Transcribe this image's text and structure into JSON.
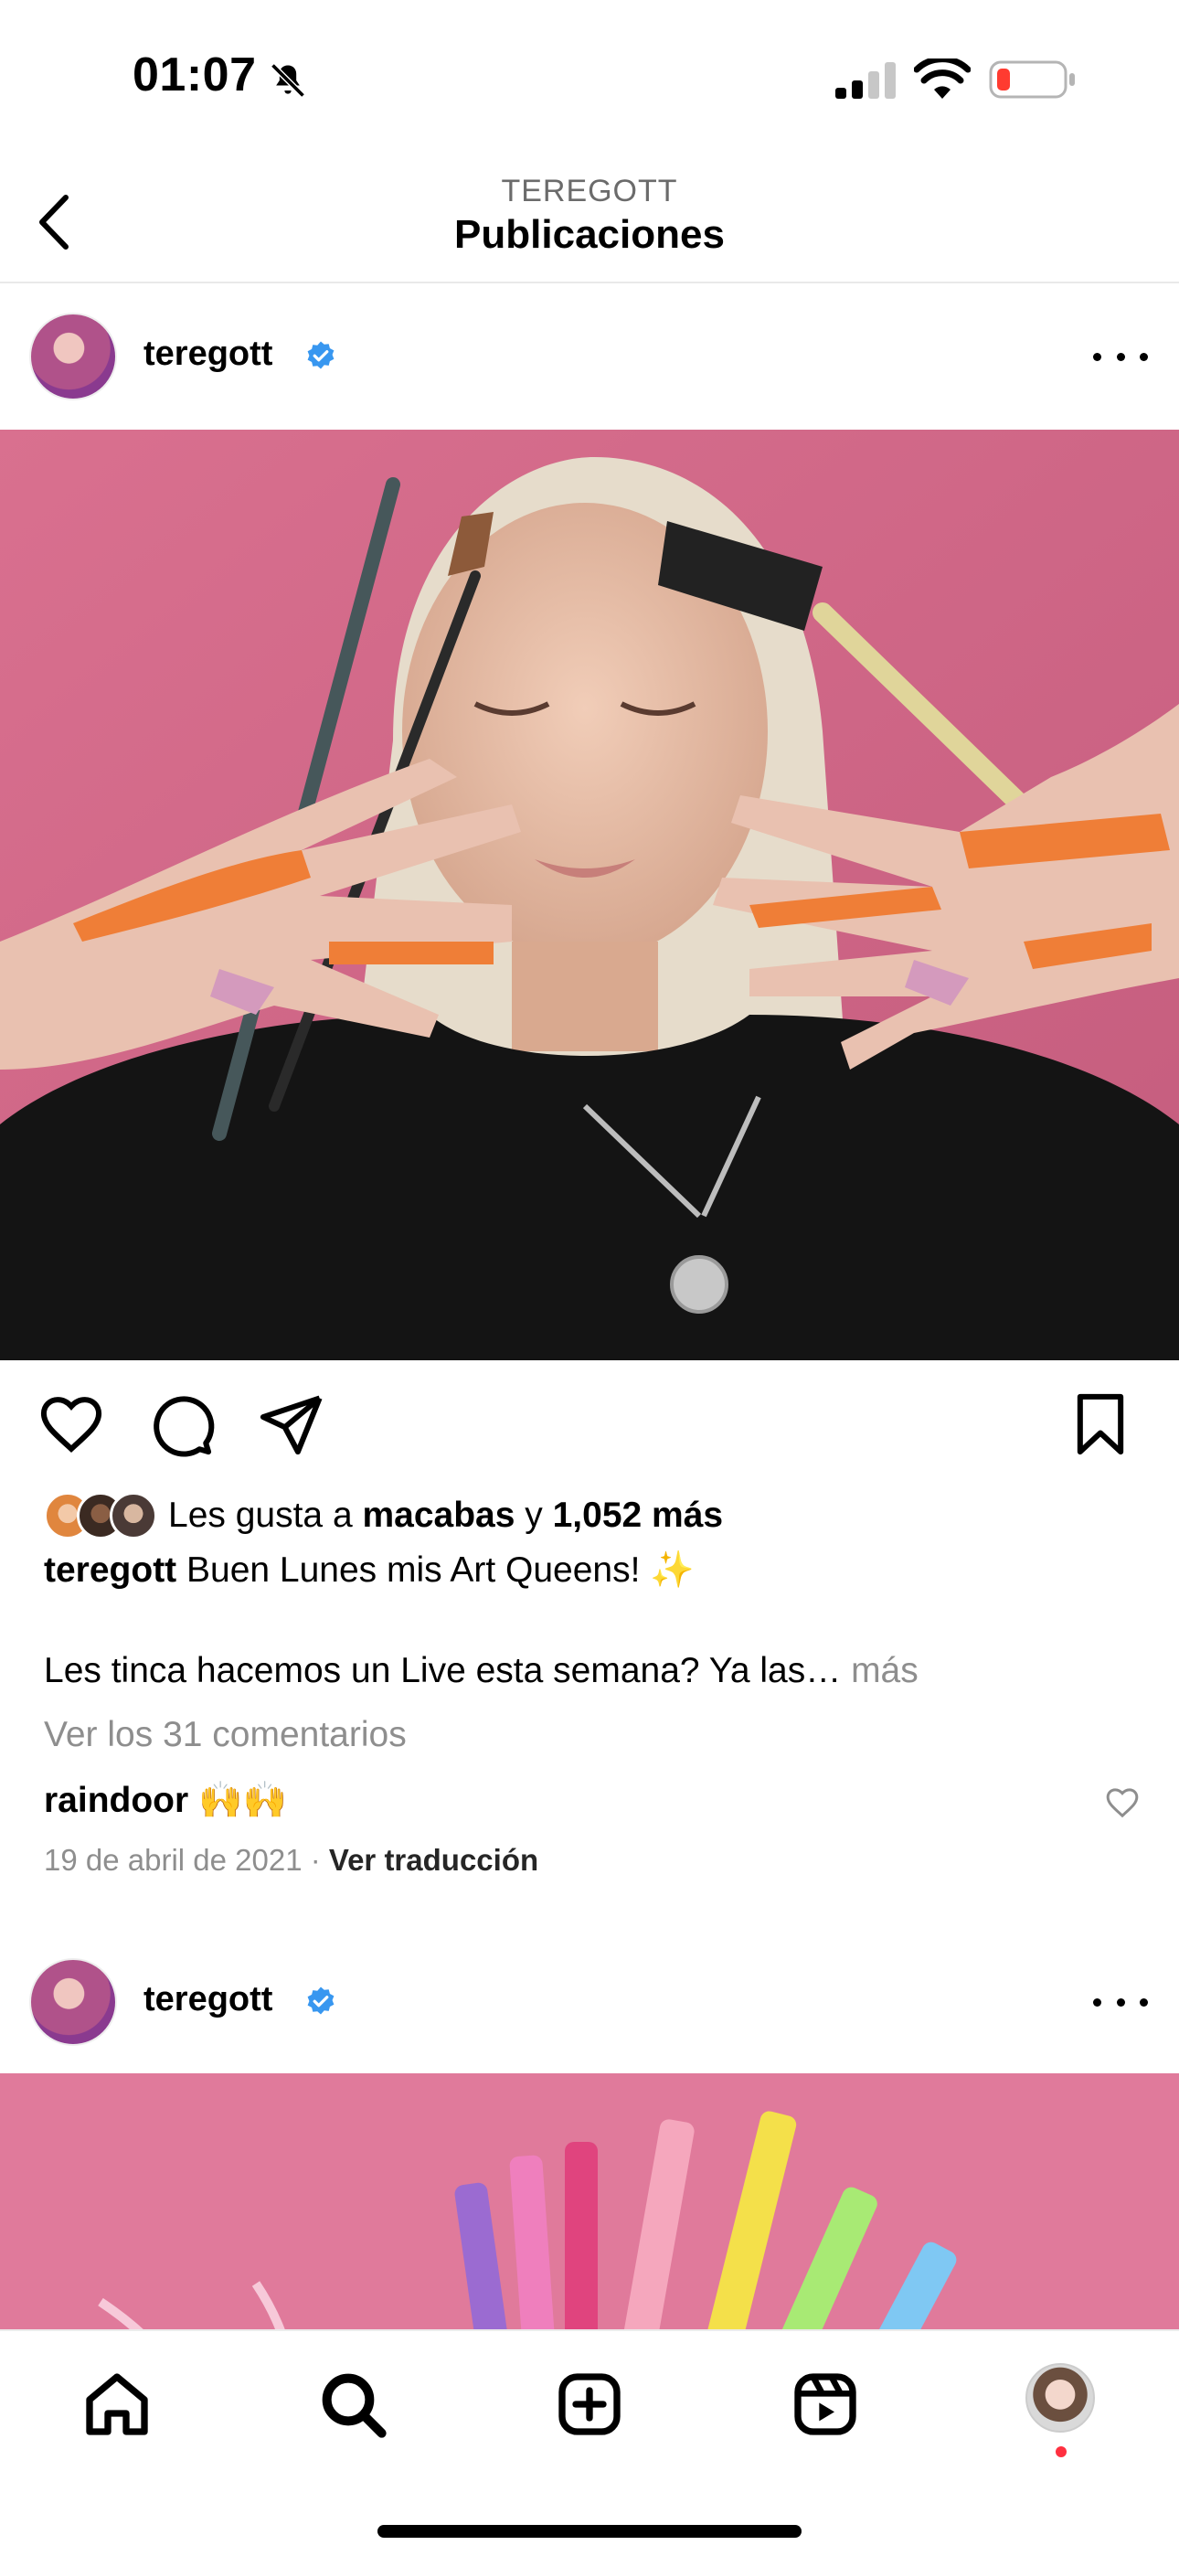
{
  "status_bar": {
    "time": "01:07",
    "icons": [
      "bell-slash-icon",
      "cellular-signal-icon",
      "wifi-icon",
      "battery-low-icon"
    ],
    "battery_color": "#ff3b30"
  },
  "header": {
    "subtitle": "TEREGOTT",
    "title": "Publicaciones",
    "back_icon": "chevron-left-icon"
  },
  "posts": [
    {
      "username": "teregott",
      "verified": true,
      "image_desc_icon": "photo",
      "likes": {
        "prefix": "Les gusta a ",
        "first_liker": "macabas",
        "connector": " y ",
        "count": "1,052 más"
      },
      "caption_user": "teregott",
      "caption_text": " Buen Lunes mis Art Queens! ✨",
      "caption_line2": "Les tinca hacemos un Live esta semana? Ya las… ",
      "more_label": "más",
      "view_comments": "Ver los 31 comentarios",
      "top_comment_user": "raindoor",
      "top_comment_text": " 🙌🙌",
      "date": "19 de abril de 2021",
      "separator": " · ",
      "translate_label": "Ver traducción"
    },
    {
      "username": "teregott",
      "verified": true
    }
  ],
  "tab_bar": {
    "items": [
      "home-icon",
      "search-icon",
      "create-icon",
      "reels-icon",
      "profile-avatar"
    ],
    "notification_color": "#ff3040"
  },
  "colors": {
    "verified_blue": "#3897f0",
    "muted_text": "#8e8e8e",
    "pink_bg": "#d96b8c"
  }
}
